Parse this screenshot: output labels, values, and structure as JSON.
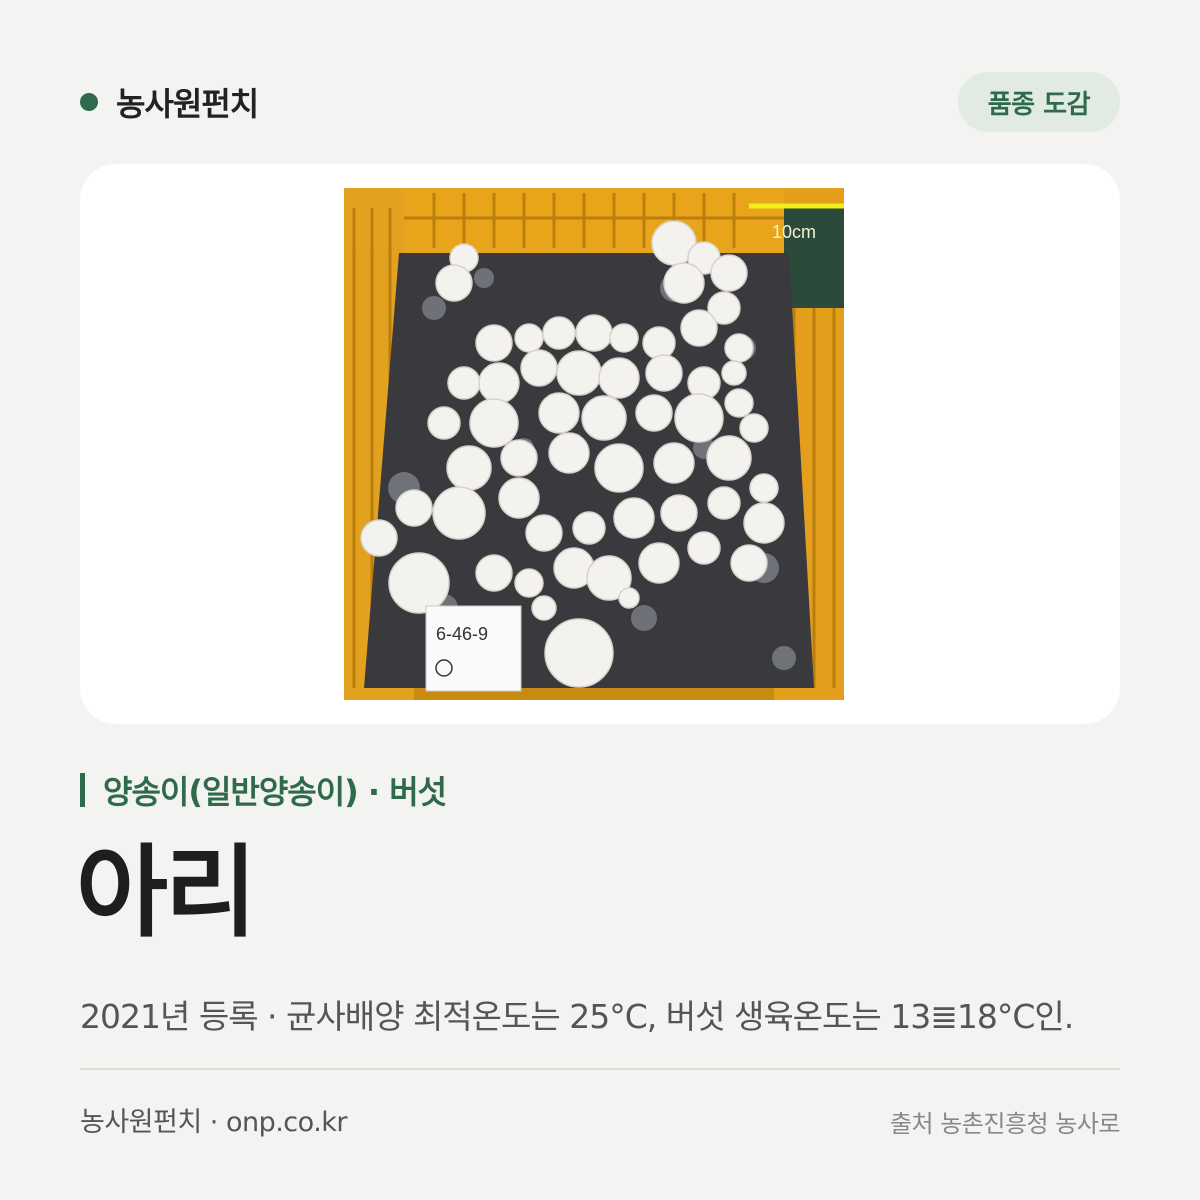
{
  "header": {
    "brand": "농사원펀치",
    "badge": "품종 도감"
  },
  "photo": {
    "scale_label": "10cm",
    "tag_label": "6-46-9"
  },
  "variety": {
    "category": "양송이(일반양송이) · 버섯",
    "name": "아리",
    "description": "2021년 등록 · 균사배양 최적온도는 25°C, 버섯 생육온도는 13≣18°C인."
  },
  "footer": {
    "site": "농사원펀치 · onp.co.kr",
    "source": "출처 농촌진흥청 농사로"
  },
  "colors": {
    "accent": "#2f6b4a",
    "badge_bg": "#e1ebe4",
    "page_bg": "#f3f3f1",
    "crate": "#e8a51c"
  }
}
